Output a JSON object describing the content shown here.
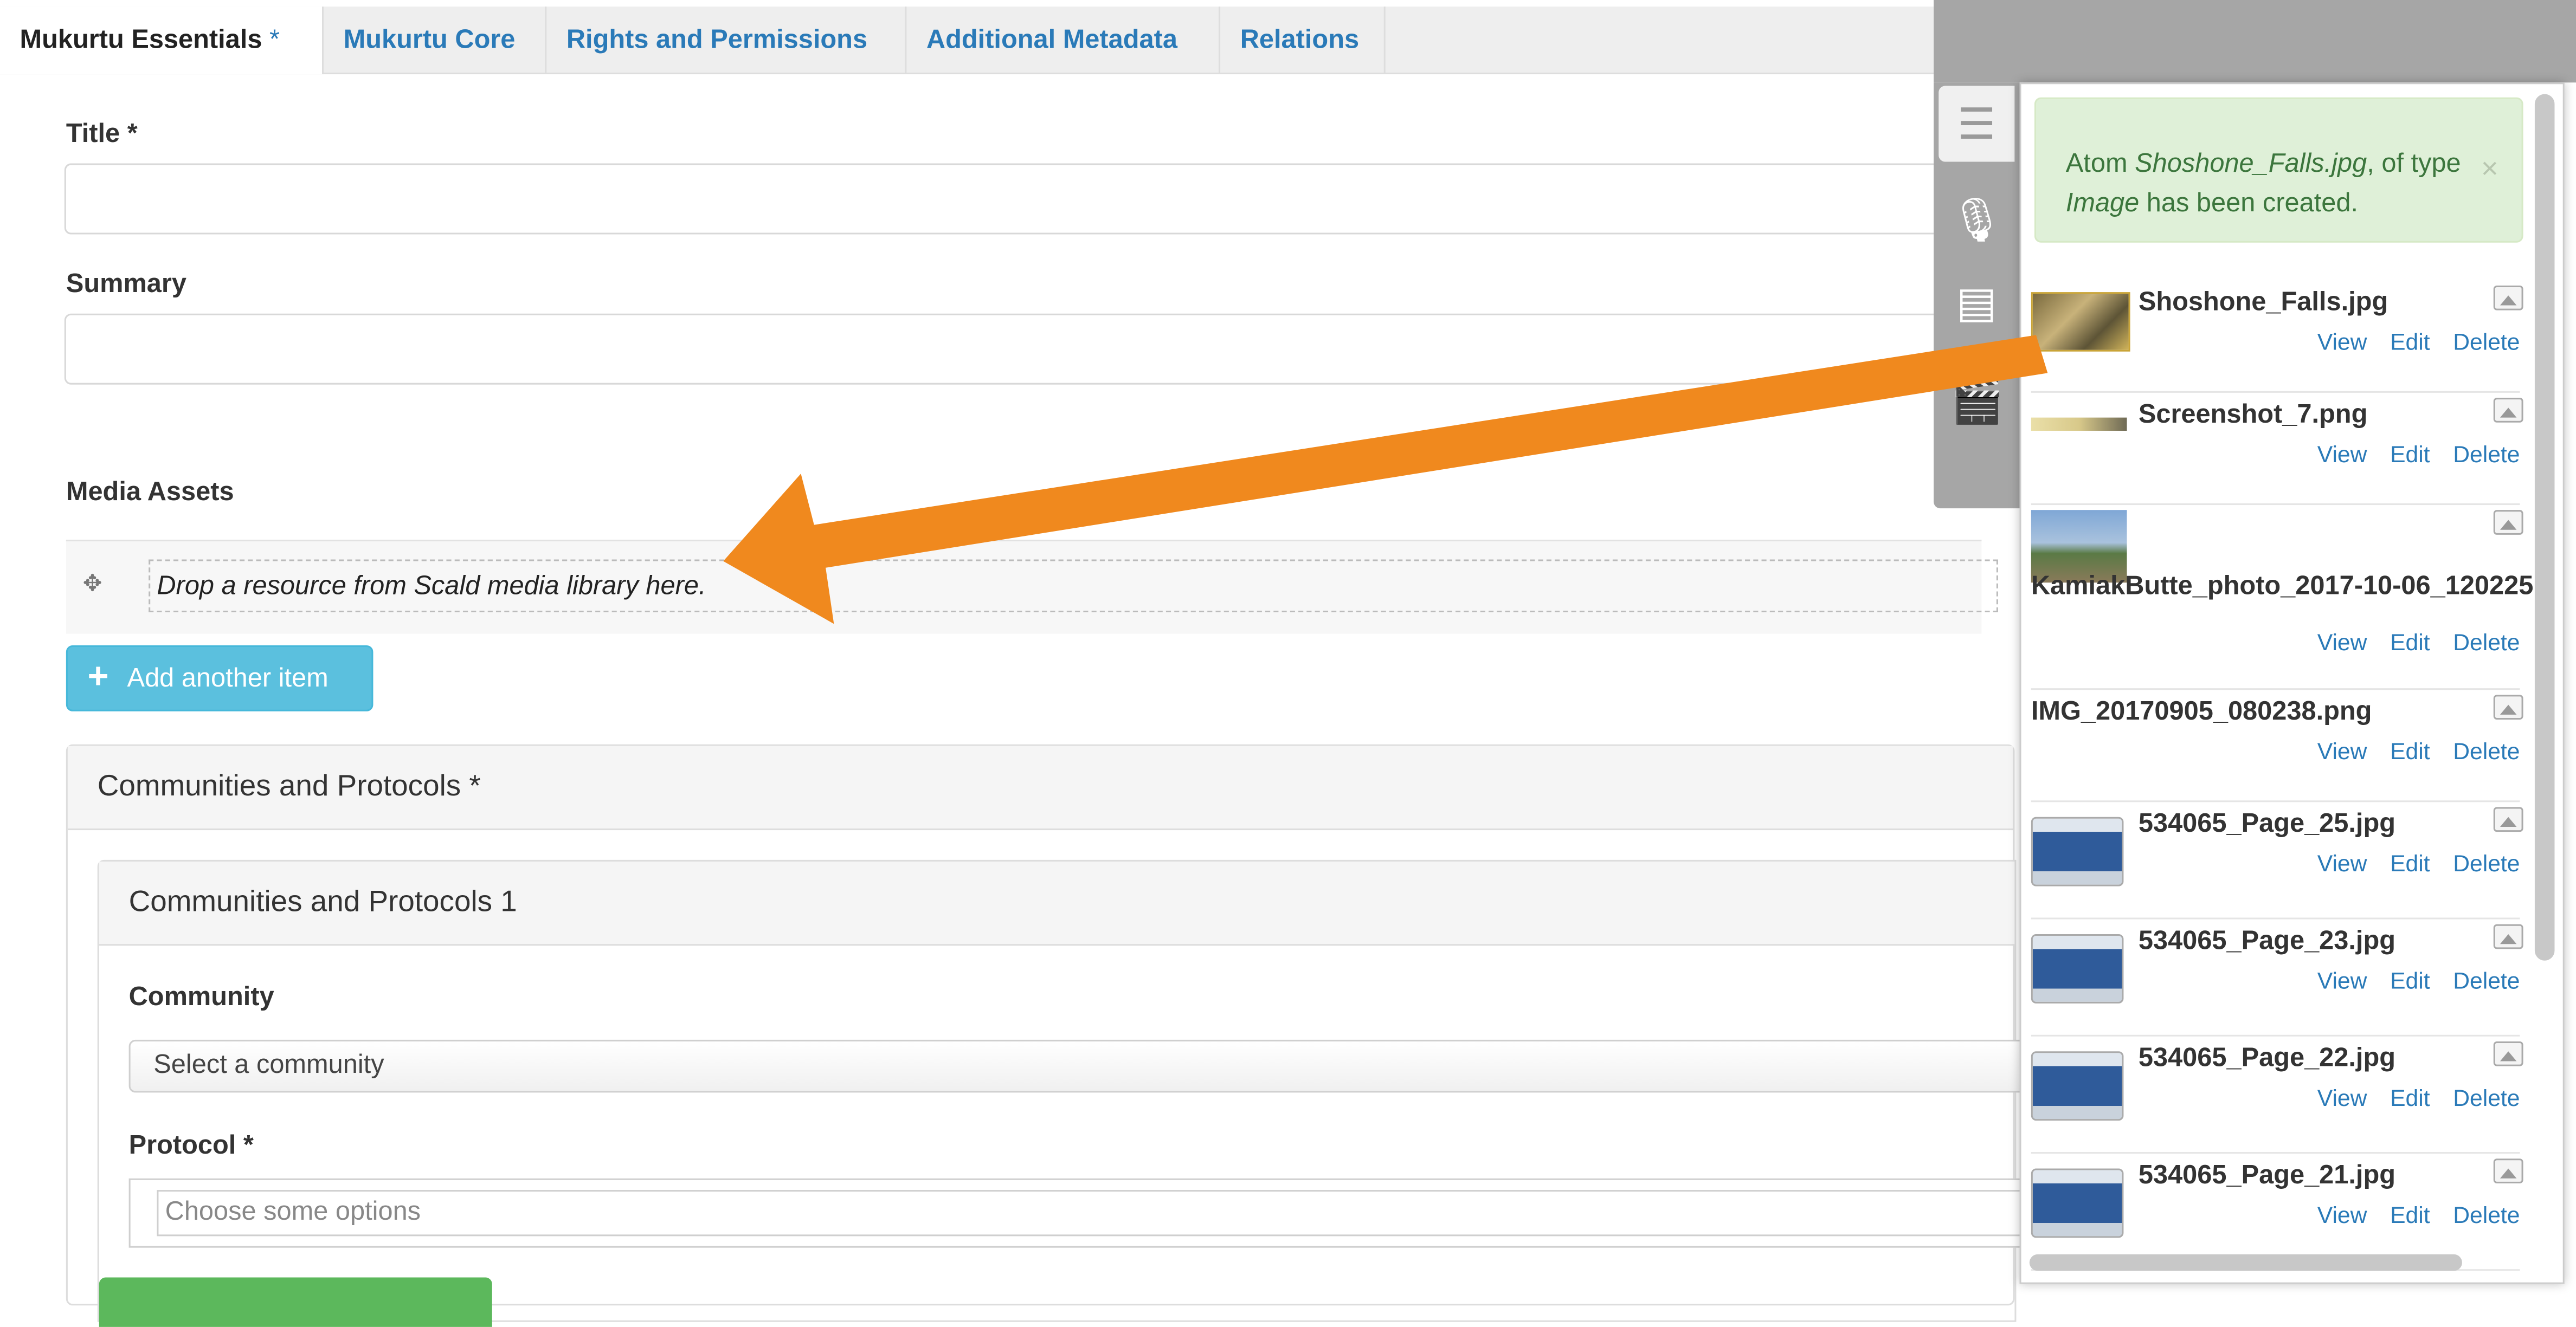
{
  "tabs": [
    {
      "label": "Mukurtu Essentials",
      "marker": "*"
    },
    {
      "label": "Mukurtu Core"
    },
    {
      "label": "Rights and Permissions"
    },
    {
      "label": "Additional Metadata"
    },
    {
      "label": "Relations"
    }
  ],
  "form": {
    "title_label": "Title *",
    "title_value": "",
    "summary_label": "Summary",
    "summary_value": "",
    "media_label": "Media Assets",
    "dropzone_text": "Drop a resource from Scald media library here.",
    "add_item_label": "Add another item",
    "communities_label": "Communities and Protocols *",
    "communities_sub_label": "Communities and Protocols 1",
    "community_label": "Community",
    "community_value": "Select a community",
    "protocol_label": "Protocol *",
    "protocol_placeholder": "Choose some options"
  },
  "scald": {
    "notice": {
      "prefix": "Atom ",
      "atom_name": "Shoshone_Falls.jpg",
      "middle": ", of type ",
      "atom_type": "Image",
      "suffix": " has been created.",
      "close": "×"
    },
    "actions": {
      "view": "View",
      "edit": "Edit",
      "delete": "Delete"
    },
    "items": [
      {
        "name": "Shoshone_Falls.jpg"
      },
      {
        "name": "Screenshot_7.png"
      },
      {
        "name": "KamiakButte_photo_2017-10-06_120225"
      },
      {
        "name": "IMG_20170905_080238.png"
      },
      {
        "name": "534065_Page_25.jpg"
      },
      {
        "name": "534065_Page_23.jpg"
      },
      {
        "name": "534065_Page_22.jpg"
      },
      {
        "name": "534065_Page_21.jpg"
      }
    ]
  },
  "colors": {
    "link": "#2a7ab8",
    "arrow": "#f0891e",
    "add_button": "#5bc0de",
    "notice_bg": "#dff0d8"
  },
  "icons": [
    "library-list-icon",
    "audio-icon",
    "document-icon",
    "video-icon",
    "move-icon",
    "plus-icon",
    "image-type-icon",
    "close-icon"
  ]
}
